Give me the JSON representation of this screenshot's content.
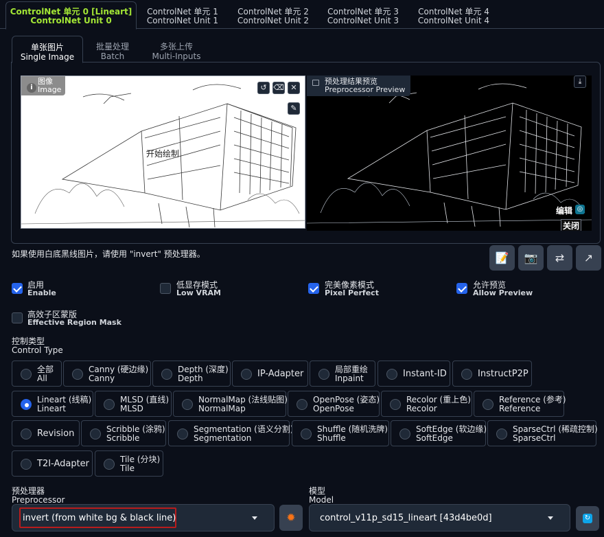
{
  "unit_tabs": [
    {
      "l1": "ControlNet 单元 0 [Lineart]",
      "l2": "ControlNet Unit 0"
    },
    {
      "l1": "ControlNet 单元 1",
      "l2": "ControlNet Unit 1"
    },
    {
      "l1": "ControlNet 单元 2",
      "l2": "ControlNet Unit 2"
    },
    {
      "l1": "ControlNet 单元 3",
      "l2": "ControlNet Unit 3"
    },
    {
      "l1": "ControlNet 单元 4",
      "l2": "ControlNet Unit 4"
    }
  ],
  "input_tabs": [
    {
      "l1": "单张图片",
      "l2": "Single Image"
    },
    {
      "l1": "批量处理",
      "l2": "Batch"
    },
    {
      "l1": "多张上传",
      "l2": "Multi-Inputs"
    }
  ],
  "image_panel": {
    "label_cn": "图像",
    "label_en": "Image",
    "center_text": "开始绘制"
  },
  "preview_panel": {
    "label_cn": "预处理结果预览",
    "label_en": "Preprocessor Preview",
    "edit": "编辑",
    "close": "关闭"
  },
  "hint": "如果使用白底黑线图片，请使用 \"invert\" 预处理器。",
  "checkboxes": [
    {
      "cn": "启用",
      "en": "Enable",
      "checked": true
    },
    {
      "cn": "低显存模式",
      "en": "Low VRAM",
      "checked": false
    },
    {
      "cn": "完美像素模式",
      "en": "Pixel Perfect",
      "checked": true
    },
    {
      "cn": "允许预览",
      "en": "Allow Preview",
      "checked": true
    },
    {
      "cn": "高效子区蒙版",
      "en": "Effective Region Mask",
      "checked": false
    }
  ],
  "control_type": {
    "cn": "控制类型",
    "en": "Control Type"
  },
  "radios": [
    {
      "cn": "全部",
      "en": "All"
    },
    {
      "cn": "Canny (硬边缘)",
      "en": "Canny"
    },
    {
      "cn": "Depth (深度)",
      "en": "Depth"
    },
    {
      "cn": "IP-Adapter",
      "en": ""
    },
    {
      "cn": "局部重绘",
      "en": "Inpaint"
    },
    {
      "cn": "Instant-ID",
      "en": ""
    },
    {
      "cn": "InstructP2P",
      "en": ""
    },
    {
      "cn": "Lineart (线稿)",
      "en": "Lineart"
    },
    {
      "cn": "MLSD (直线)",
      "en": "MLSD"
    },
    {
      "cn": "NormalMap (法线贴图)",
      "en": "NormalMap"
    },
    {
      "cn": "OpenPose (姿态)",
      "en": "OpenPose"
    },
    {
      "cn": "Recolor (重上色)",
      "en": "Recolor"
    },
    {
      "cn": "Reference (参考)",
      "en": "Reference"
    },
    {
      "cn": "Revision",
      "en": ""
    },
    {
      "cn": "Scribble (涂鸦)",
      "en": "Scribble"
    },
    {
      "cn": "Segmentation (语义分割)",
      "en": "Segmentation"
    },
    {
      "cn": "Shuffle (随机洗牌)",
      "en": "Shuffle"
    },
    {
      "cn": "SoftEdge (软边缘)",
      "en": "SoftEdge"
    },
    {
      "cn": "SparseCtrl (稀疏控制)",
      "en": "SparseCtrl"
    },
    {
      "cn": "T2I-Adapter",
      "en": ""
    },
    {
      "cn": "Tile (分块)",
      "en": "Tile"
    }
  ],
  "selected_control": "Lineart",
  "preprocessor": {
    "cn": "预处理器",
    "en": "Preprocessor",
    "value": "invert (from white bg & black line)"
  },
  "model": {
    "cn": "模型",
    "en": "Model",
    "value": "control_v11p_sd15_lineart [43d4be0d]"
  },
  "colors": {
    "accent": "#a3e635",
    "checkbox": "#2563eb",
    "highlight_border": "#b91c1c"
  }
}
